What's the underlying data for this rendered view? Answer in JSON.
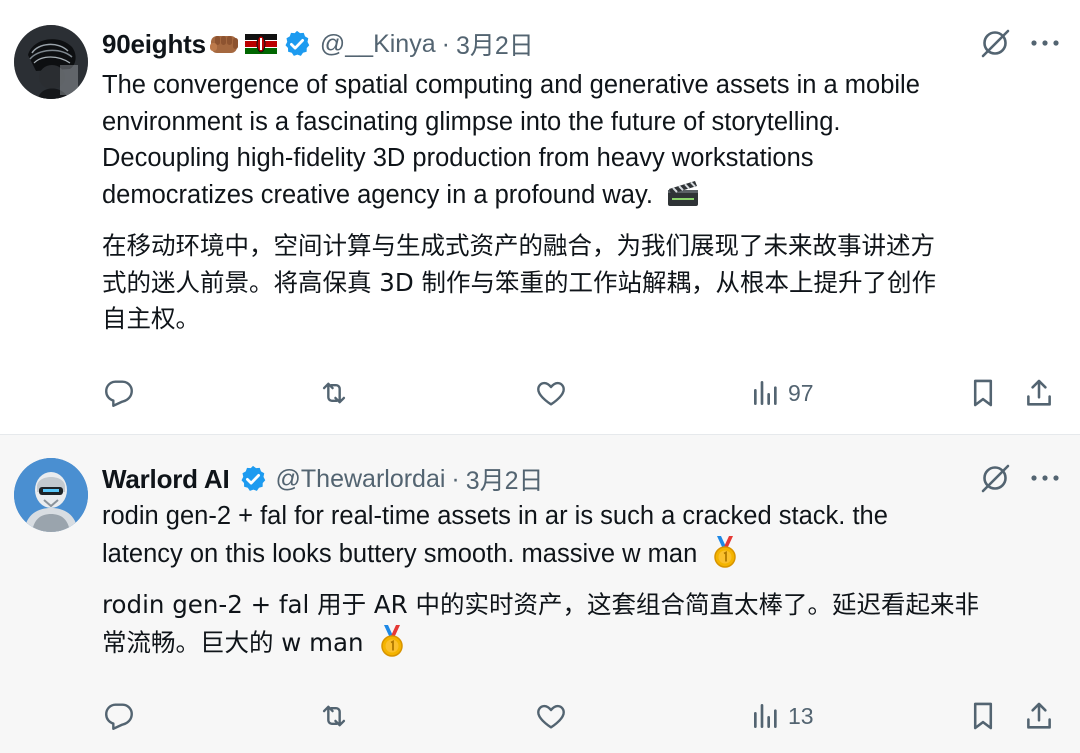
{
  "tweets": [
    {
      "author": "90eights",
      "flair_emojis": [
        "fist-bump-emoji",
        "kenya-flag-emoji"
      ],
      "handle": "@__Kinya",
      "separator": "·",
      "date": "3月2日",
      "text_en": [
        "The convergence of spatial computing and generative assets in a mobile",
        "environment is a fascinating glimpse into the future of storytelling.",
        "Decoupling high-fidelity 3D production from heavy workstations",
        "democratizes creative agency in a profound way."
      ],
      "text_en_emoji": "clapper-board-emoji",
      "text_zh": [
        "在移动环境中，空间计算与生成式资产的融合，为我们展现了未来故事讲述方",
        "式的迷人前景。将高保真 3D 制作与笨重的工作站解耦，从根本上提升了创作",
        "自主权。"
      ],
      "views": "97"
    },
    {
      "author": "Warlord AI",
      "handle": "@Thewarlordai",
      "separator": "·",
      "date": "3月2日",
      "text_en": [
        "rodin gen-2 + fal for real-time assets in ar is such a cracked stack. the",
        "latency on this looks buttery smooth. massive w man"
      ],
      "text_en_emoji": "gold-medal-emoji",
      "text_zh": [
        "rodin gen-2 + fal 用于 AR 中的实时资产，这套组合简直太棒了。延迟看起来非",
        "常流畅。巨大的 w man"
      ],
      "text_zh_emoji": "gold-medal-emoji",
      "views": "13"
    }
  ],
  "colors": {
    "text": "#0f1419",
    "secondary": "#536471",
    "verified": "#1d9bf0",
    "reply_background": "#f7f7f7"
  },
  "icons": [
    "grok-icon",
    "more-icon",
    "reply-icon",
    "retweet-icon",
    "like-icon",
    "views-icon",
    "bookmark-icon",
    "share-icon"
  ]
}
